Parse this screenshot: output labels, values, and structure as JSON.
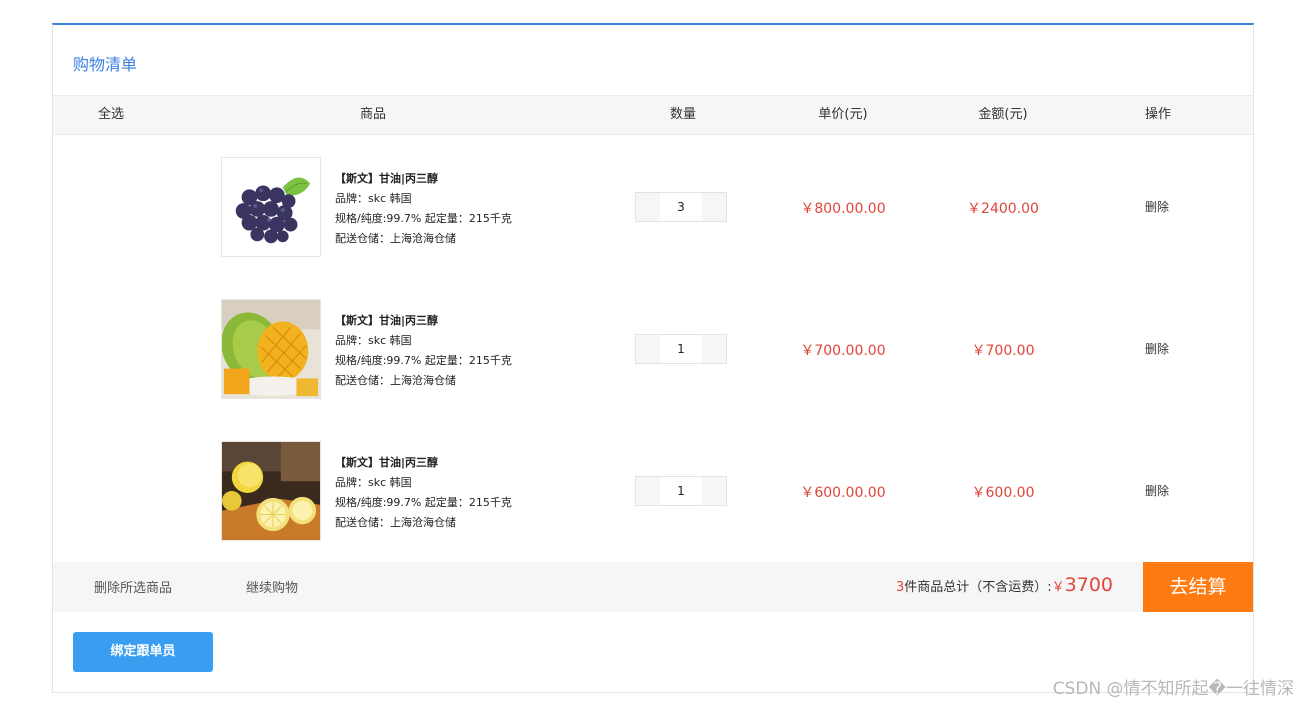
{
  "panel": {
    "title": "购物清单"
  },
  "table_headers": {
    "select_all": "全选",
    "product": "商品",
    "quantity": "数量",
    "unit_price": "单价(元)",
    "amount": "金额(元)",
    "action": "操作"
  },
  "items": [
    {
      "image": "grapes-photo",
      "name": "【斯文】甘油|丙三醇",
      "brand": "品牌：skc  韩国",
      "spec": "规格/纯度:99.7%  起定量：215千克",
      "warehouse": "配送仓储：上海沧海仓储",
      "quantity": "3",
      "unit_price": "￥800.00.00",
      "amount": "￥2400.00",
      "delete_label": "删除"
    },
    {
      "image": "mango-photo",
      "name": "【斯文】甘油|丙三醇",
      "brand": "品牌：skc  韩国",
      "spec": "规格/纯度:99.7%  起定量：215千克",
      "warehouse": "配送仓储：上海沧海仓储",
      "quantity": "1",
      "unit_price": "￥700.00.00",
      "amount": "￥700.00",
      "delete_label": "删除"
    },
    {
      "image": "lemon-photo",
      "name": "【斯文】甘油|丙三醇",
      "brand": "品牌：skc  韩国",
      "spec": "规格/纯度:99.7%  起定量：215千克",
      "warehouse": "配送仓储：上海沧海仓储",
      "quantity": "1",
      "unit_price": "￥600.00.00",
      "amount": "￥600.00",
      "delete_label": "删除"
    }
  ],
  "footer": {
    "delete_selected": "删除所选商品",
    "continue_shopping": "继续购物",
    "item_count": "3",
    "summary_text": "件商品总计（不含运费）:",
    "currency": "￥",
    "total": "3700",
    "checkout": "去结算"
  },
  "bind_button": "绑定跟单员",
  "watermark": "CSDN @情不知所起�一往情深",
  "colors": {
    "accent": "#3b7fe0",
    "price": "#e0453a",
    "checkout": "#ff7a10",
    "bind_button": "#3a9ef0"
  }
}
